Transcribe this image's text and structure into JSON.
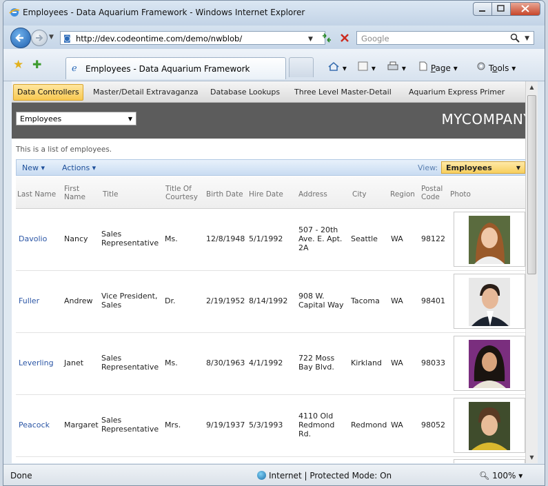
{
  "window": {
    "title": "Employees - Data Aquarium Framework - Windows Internet Explorer"
  },
  "address_bar": {
    "url": "http://dev.codeontime.com/demo/nwblob/",
    "search_placeholder": "Google"
  },
  "browser_tab": {
    "label": "Employees - Data Aquarium Framework"
  },
  "command_bar": {
    "page_label": "Page",
    "page_accel": "P",
    "page_rest": "age",
    "tools_label": "Tools",
    "tools_pre": "T",
    "tools_accel": "o",
    "tools_rest": "ols"
  },
  "site_menu": {
    "items": [
      {
        "label": "Data Controllers",
        "active": true
      },
      {
        "label": "Master/Detail Extravaganza"
      },
      {
        "label": "Database Lookups"
      },
      {
        "label": "Three Level Master-Detail"
      },
      {
        "label": "Aquarium Express Primer"
      }
    ]
  },
  "banner": {
    "controller_select": "Employees",
    "company": "MYCOMPANY"
  },
  "description": "This is a list of employees.",
  "action_bar": {
    "new_label": "New ▾",
    "actions_label": "Actions ▾",
    "view_label": "View:",
    "view_value": "Employees"
  },
  "grid": {
    "columns": {
      "last_name": "Last Name",
      "first_name_1": "First",
      "first_name_2": "Name",
      "title": "Title",
      "courtesy_1": "Title Of",
      "courtesy_2": "Courtesy",
      "birth_date": "Birth Date",
      "hire_date": "Hire Date",
      "address": "Address",
      "city": "City",
      "region": "Region",
      "postal_1": "Postal",
      "postal_2": "Code",
      "photo": "Photo"
    },
    "rows": [
      {
        "last_name": "Davolio",
        "first_name": "Nancy",
        "title_1": "Sales",
        "title_2": "Representative",
        "courtesy": "Ms.",
        "birth_date": "12/8/1948",
        "hire_date": "5/1/1992",
        "address_1": "507 - 20th",
        "address_2": "Ave. E. Apt.",
        "address_3": "2A",
        "city": "Seattle",
        "region": "WA",
        "postal": "98122"
      },
      {
        "last_name": "Fuller",
        "first_name": "Andrew",
        "title_1": "Vice President,",
        "title_2": "Sales",
        "courtesy": "Dr.",
        "birth_date": "2/19/1952",
        "hire_date": "8/14/1992",
        "address_1": "908 W.",
        "address_2": "Capital Way",
        "address_3": "",
        "city": "Tacoma",
        "region": "WA",
        "postal": "98401"
      },
      {
        "last_name": "Leverling",
        "first_name": "Janet",
        "title_1": "Sales",
        "title_2": "Representative",
        "courtesy": "Ms.",
        "birth_date": "8/30/1963",
        "hire_date": "4/1/1992",
        "address_1": "722 Moss",
        "address_2": "Bay Blvd.",
        "address_3": "",
        "city": "Kirkland",
        "region": "WA",
        "postal": "98033"
      },
      {
        "last_name": "Peacock",
        "first_name": "Margaret",
        "title_1": "Sales",
        "title_2": "Representative",
        "courtesy": "Mrs.",
        "birth_date": "9/19/1937",
        "hire_date": "5/3/1993",
        "address_1": "4110 Old",
        "address_2": "Redmond",
        "address_3": "Rd.",
        "city": "Redmond",
        "region": "WA",
        "postal": "98052"
      }
    ]
  },
  "status_bar": {
    "status": "Done",
    "zone": "Internet | Protected Mode: On",
    "zoom": "100%"
  },
  "colors": {
    "link": "#2a55a5",
    "banner": "#5c5c5c",
    "active_tab": "#f8c850"
  }
}
